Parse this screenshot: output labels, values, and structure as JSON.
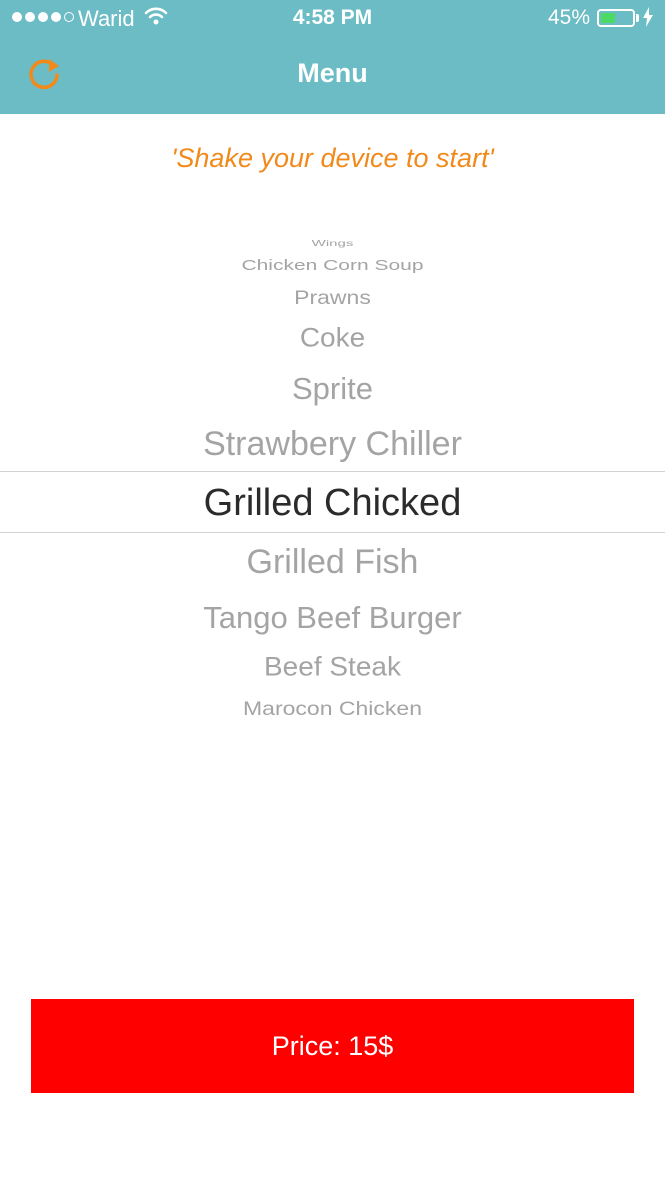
{
  "status_bar": {
    "carrier": "Warid",
    "time": "4:58 PM",
    "battery_percent": "45%",
    "battery_level": 0.45
  },
  "nav_bar": {
    "title": "Menu",
    "refresh_icon": "refresh-icon"
  },
  "hint_text": "'Shake your device to start'",
  "picker": {
    "items": [
      "Wings",
      "Chicken Corn Soup",
      "Prawns",
      "Coke",
      "Sprite",
      "Strawbery Chiller",
      "Grilled Chicked",
      "Grilled Fish",
      "Tango Beef Burger",
      "Beef Steak",
      "Marocon Chicken"
    ],
    "selected_index": 6
  },
  "price_button": {
    "label": "Price: 15$"
  },
  "colors": {
    "header": "#6bbcc4",
    "accent": "#f18a1b",
    "price_button": "#ff0000"
  }
}
